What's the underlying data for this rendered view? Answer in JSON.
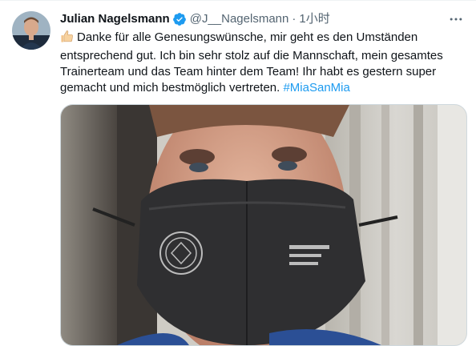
{
  "tweet": {
    "author_name": "Julian Nagelsmann",
    "handle": "@J__Nagelsmann",
    "separator": "·",
    "time": "1小时",
    "text_lines": [
      "Danke für alle Genesungswünsche, mir geht es den Umständen",
      "entsprechend gut. Ich bin sehr stolz auf die Mannschaft, mein gesamtes",
      "Trainerteam und das Team hinter dem Team! Ihr habt es gestern super",
      "gemacht und mich bestmöglich vertreten. "
    ],
    "hashtag": "#MiaSanMia",
    "leading_emoji": "thumbs-up-icon"
  },
  "colors": {
    "text": "#0f1419",
    "secondary": "#536471",
    "accent": "#1d9bf0",
    "border": "#cfd9de",
    "verified": "#1d9bf0"
  },
  "icons": {
    "verified": "verified-badge-icon",
    "more": "more-options-icon"
  }
}
